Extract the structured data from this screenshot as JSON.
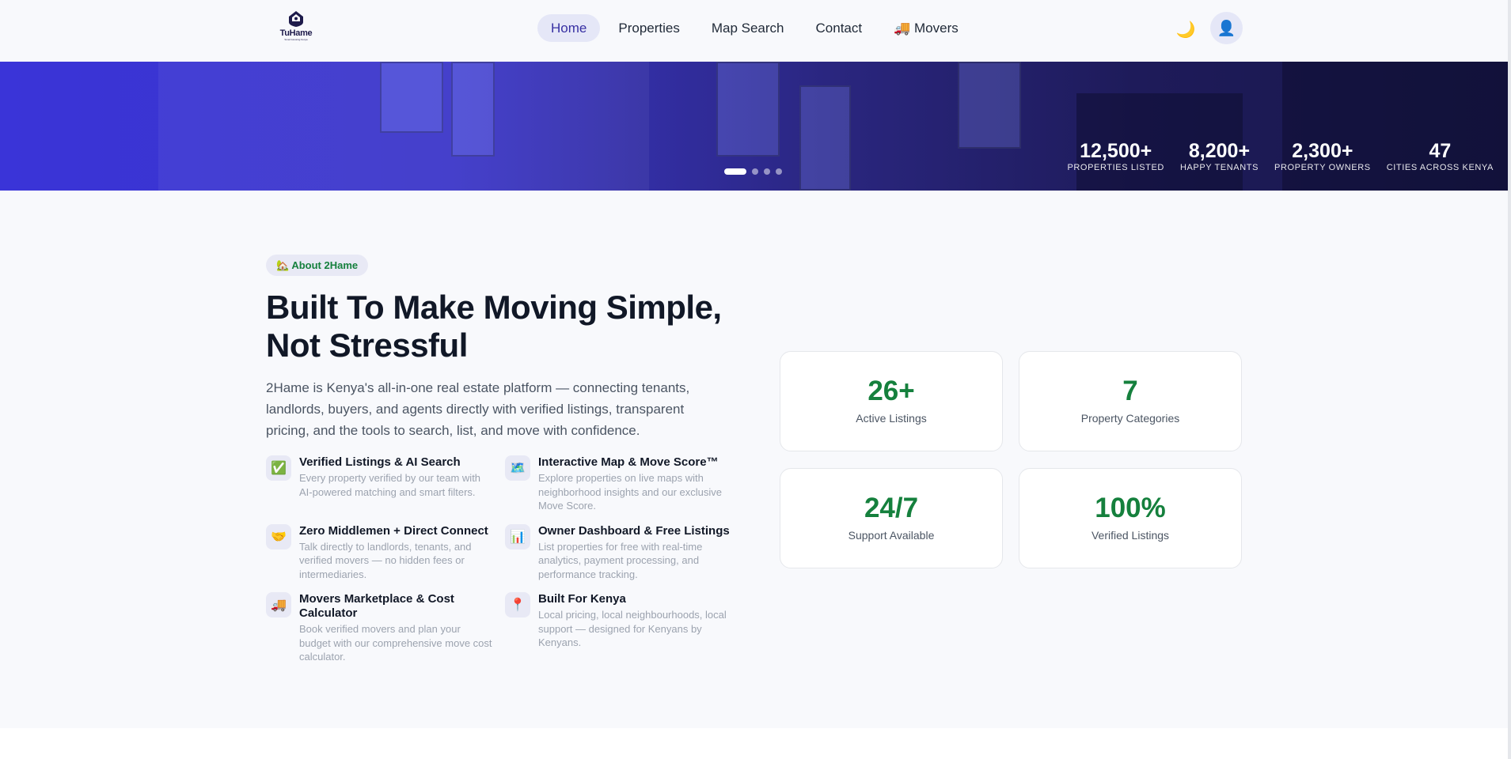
{
  "brand": {
    "name": "TuHame",
    "tagline": "Smart Housing Kenya"
  },
  "nav": {
    "items": [
      {
        "label": "Home",
        "active": true
      },
      {
        "label": "Properties",
        "active": false
      },
      {
        "label": "Map Search",
        "active": false
      },
      {
        "label": "Contact",
        "active": false
      },
      {
        "label": "🚚 Movers",
        "active": false
      }
    ],
    "theme_icon": "moon-icon",
    "theme_glyph": "🌙",
    "user_icon": "user-icon",
    "user_glyph": "👤"
  },
  "hero": {
    "slides": 4,
    "active_slide": 1,
    "stats": [
      {
        "value": "12,500+",
        "label": "PROPERTIES LISTED"
      },
      {
        "value": "8,200+",
        "label": "HAPPY TENANTS"
      },
      {
        "value": "2,300+",
        "label": "PROPERTY OWNERS"
      },
      {
        "value": "47",
        "label": "CITIES ACROSS KENYA"
      }
    ]
  },
  "about": {
    "badge": "🏡 About 2Hame",
    "headline": "Built To Make Moving Simple, Not Stressful",
    "description": "2Hame is Kenya's all-in-one real estate platform — connecting tenants, landlords, buyers, and agents directly with verified listings, transparent pricing, and the tools to search, list, and move with confidence.",
    "features": [
      {
        "icon": "✅",
        "icon_name": "check-icon",
        "title": "Verified Listings & AI Search",
        "text": "Every property verified by our team with AI-powered matching and smart filters."
      },
      {
        "icon": "🗺️",
        "icon_name": "map-icon",
        "title": "Interactive Map & Move Score™",
        "text": "Explore properties on live maps with neighborhood insights and our exclusive Move Score."
      },
      {
        "icon": "🤝",
        "icon_name": "handshake-icon",
        "title": "Zero Middlemen + Direct Connect",
        "text": "Talk directly to landlords, tenants, and verified movers — no hidden fees or intermediaries."
      },
      {
        "icon": "📊",
        "icon_name": "chart-icon",
        "title": "Owner Dashboard & Free Listings",
        "text": "List properties for free with real-time analytics, payment processing, and performance tracking."
      },
      {
        "icon": "🚚",
        "icon_name": "truck-icon",
        "title": "Movers Marketplace & Cost Calculator",
        "text": "Book verified movers and plan your budget with our comprehensive move cost calculator."
      },
      {
        "icon": "📍",
        "icon_name": "pin-icon",
        "title": "Built For Kenya",
        "text": "Local pricing, local neighbourhoods, local support — designed for Kenyans by Kenyans."
      }
    ],
    "cards": [
      {
        "value": "26+",
        "label": "Active Listings"
      },
      {
        "value": "7",
        "label": "Property Categories"
      },
      {
        "value": "24/7",
        "label": "Support Available"
      },
      {
        "value": "100%",
        "label": "Verified Listings"
      }
    ],
    "accent_color": "#15803d",
    "brand_color": "#3730a3"
  }
}
